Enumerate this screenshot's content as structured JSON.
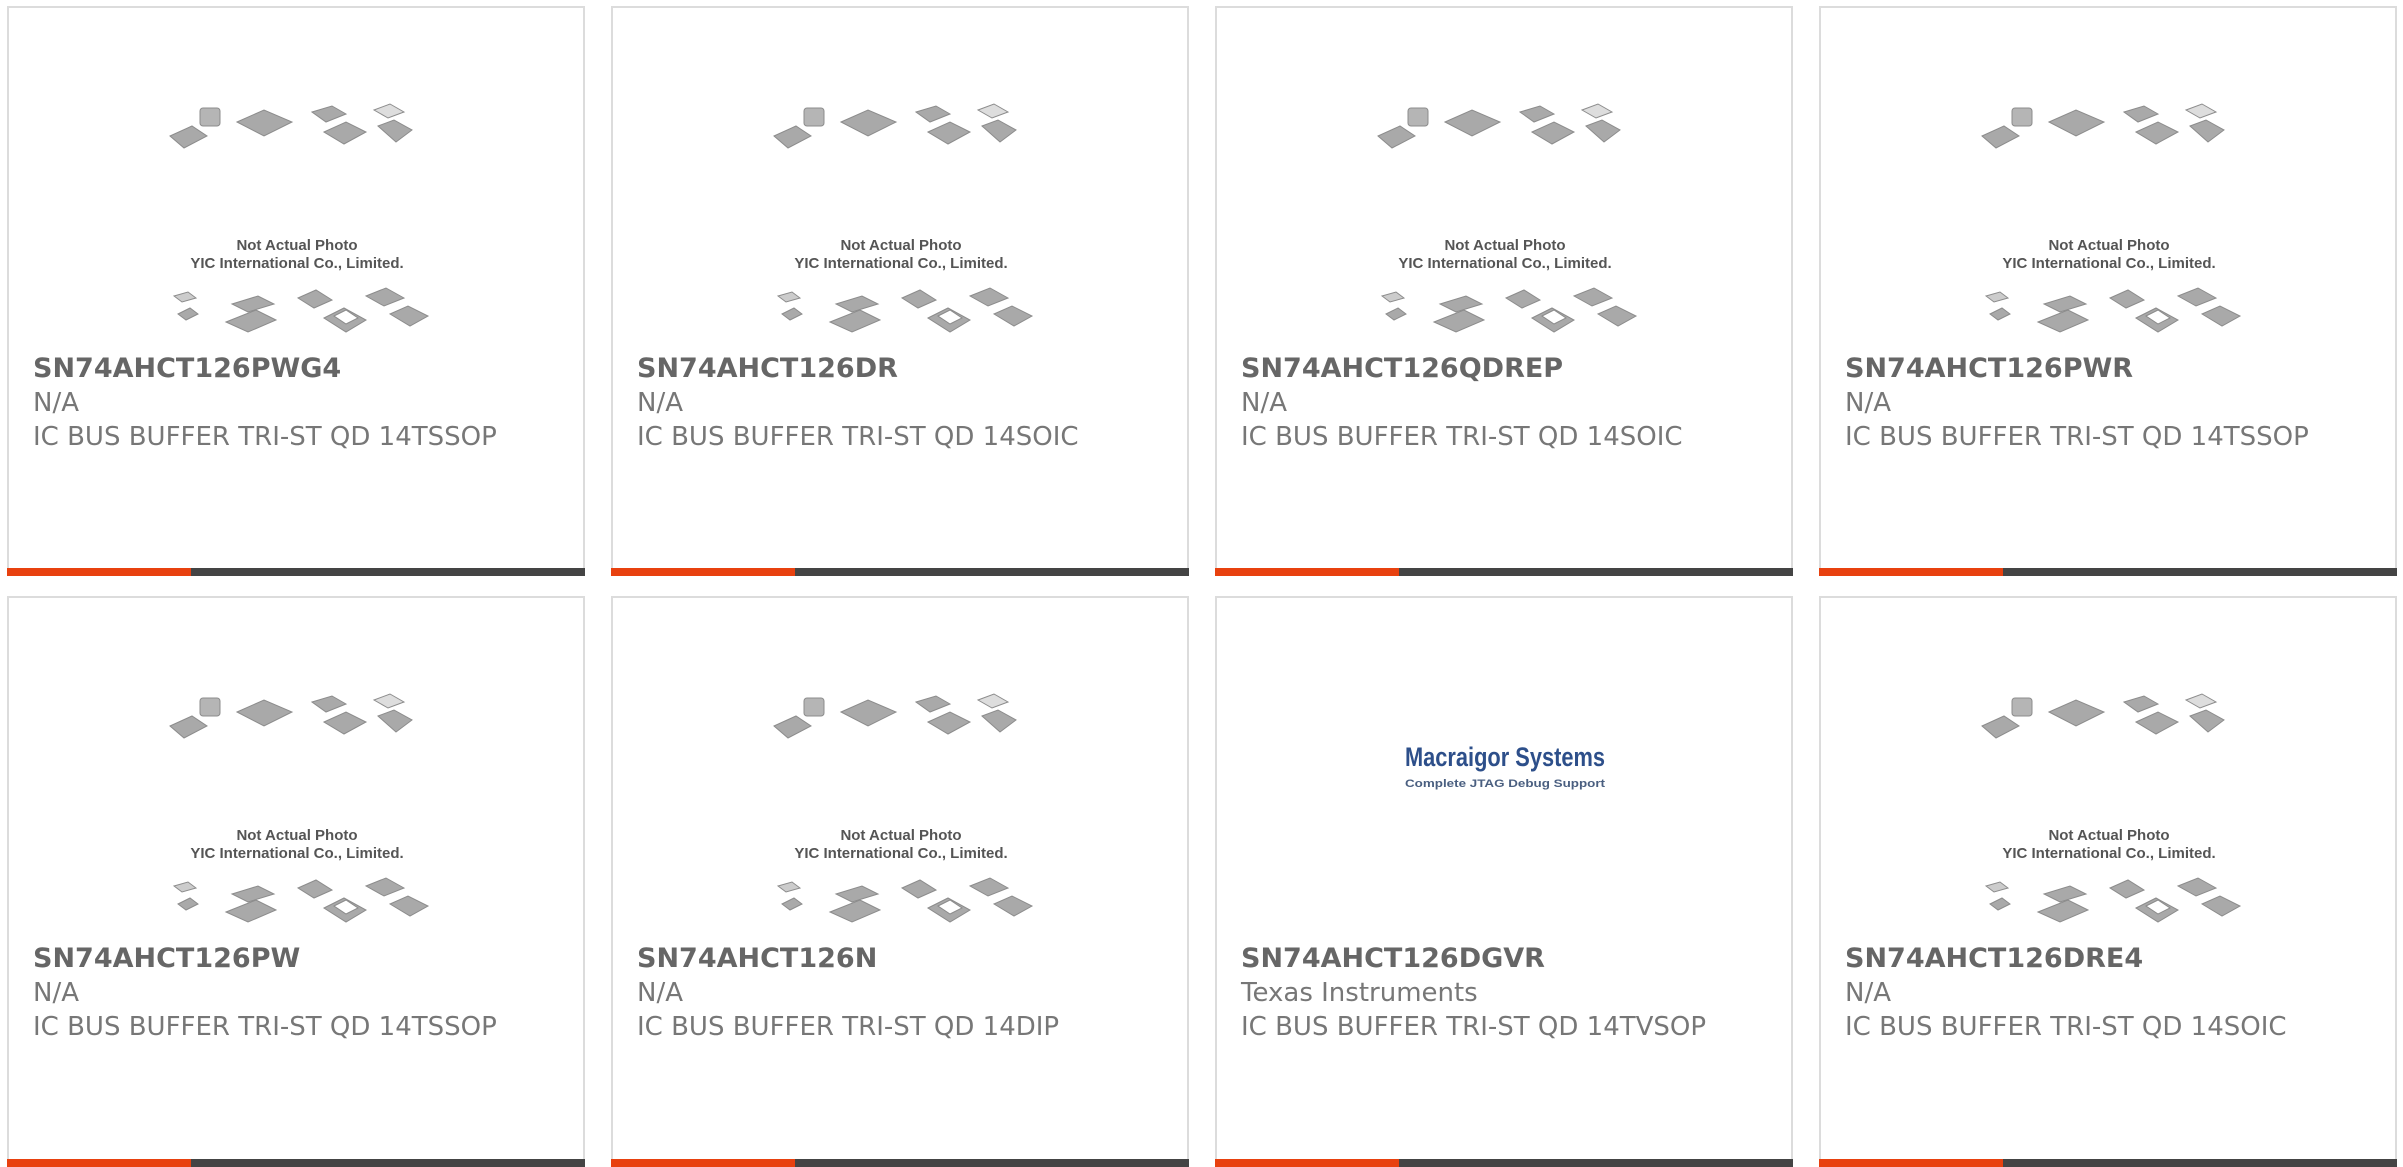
{
  "colors": {
    "accent": "#e8410f",
    "bar": "#444444",
    "text": "#777777",
    "logo_blue": "#1f74b9"
  },
  "placeholder": {
    "line1": "Not Actual Photo",
    "line2": "YIC International Co., Limited."
  },
  "macraigor": {
    "name": "Macraigor Systems",
    "tagline": "Complete JTAG Debug Support"
  },
  "products": [
    {
      "part": "SN74AHCT126PWG4",
      "manufacturer": "N/A",
      "description": "IC BUS BUFFER TRI-ST QD 14TSSOP",
      "image": "yic-placeholder"
    },
    {
      "part": "SN74AHCT126DR",
      "manufacturer": "N/A",
      "description": "IC BUS BUFFER TRI-ST QD 14SOIC",
      "image": "yic-placeholder"
    },
    {
      "part": "SN74AHCT126QDREP",
      "manufacturer": "N/A",
      "description": "IC BUS BUFFER TRI-ST QD 14SOIC",
      "image": "yic-placeholder"
    },
    {
      "part": "SN74AHCT126PWR",
      "manufacturer": "N/A",
      "description": "IC BUS BUFFER TRI-ST QD 14TSSOP",
      "image": "yic-placeholder"
    },
    {
      "part": "SN74AHCT126PW",
      "manufacturer": "N/A",
      "description": "IC BUS BUFFER TRI-ST QD 14TSSOP",
      "image": "yic-placeholder"
    },
    {
      "part": "SN74AHCT126N",
      "manufacturer": "N/A",
      "description": "IC BUS BUFFER TRI-ST QD 14DIP",
      "image": "yic-placeholder"
    },
    {
      "part": "SN74AHCT126DGVR",
      "manufacturer": "Texas Instruments",
      "description": "IC BUS BUFFER TRI-ST QD 14TVSOP",
      "image": "macraigor-logo"
    },
    {
      "part": "SN74AHCT126DRE4",
      "manufacturer": "N/A",
      "description": "IC BUS BUFFER TRI-ST QD 14SOIC",
      "image": "yic-placeholder"
    }
  ]
}
